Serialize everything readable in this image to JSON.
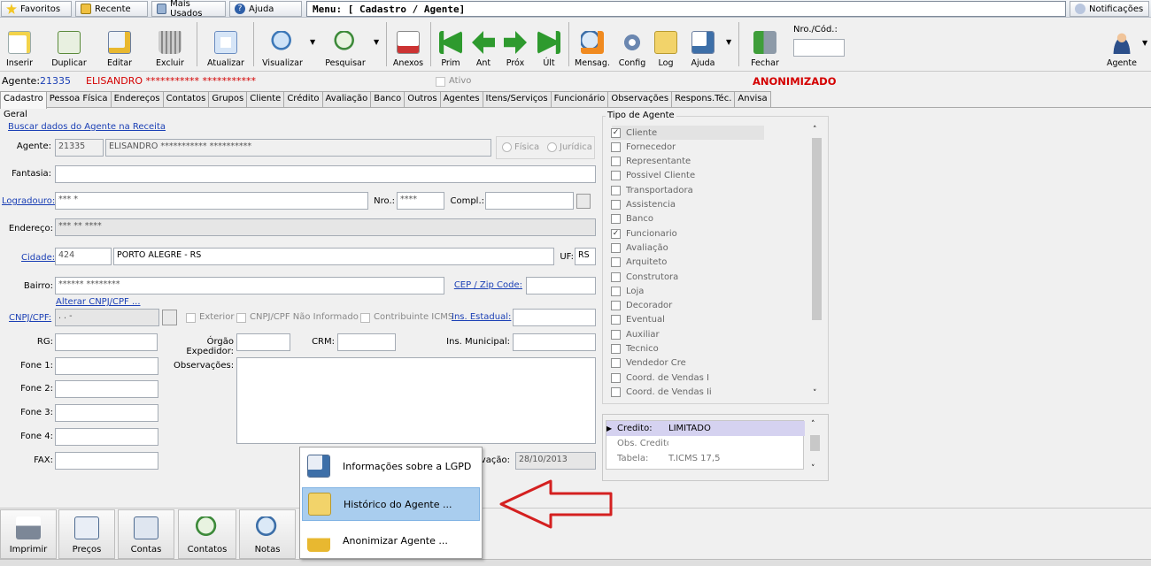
{
  "topbar": {
    "favoritos": "Favoritos",
    "recente": "Recente",
    "mais_usados": "Mais Usados",
    "ajuda": "Ajuda",
    "menu": "Menu: [ Cadastro / Agente]",
    "notificacoes": "Notificações"
  },
  "toolbar": {
    "inserir": "Inserir",
    "duplicar": "Duplicar",
    "editar": "Editar",
    "excluir": "Excluir",
    "atualizar": "Atualizar",
    "visualizar": "Visualizar",
    "pesquisar": "Pesquisar",
    "anexos": "Anexos",
    "prim": "Prim",
    "ant": "Ant",
    "prox": "Próx",
    "ult": "Últ",
    "mensag": "Mensag.",
    "config": "Config",
    "log": "Log",
    "ajuda": "Ajuda",
    "fechar": "Fechar",
    "nro_cod_label": "Nro./Cód.:",
    "agente": "Agente"
  },
  "agent_line": {
    "label": "Agente:",
    "id": "21335",
    "name": "ELISANDRO *********** ***********",
    "ativo": "Ativo",
    "status": "ANONIMIZADO"
  },
  "tabs": [
    "Cadastro",
    "Pessoa Física",
    "Endereços",
    "Contatos",
    "Grupos",
    "Cliente",
    "Crédito",
    "Avaliação",
    "Banco",
    "Outros",
    "Agentes",
    "Itens/Serviços",
    "Funcionário",
    "Observações",
    "Respons.Téc.",
    "Anvisa"
  ],
  "form": {
    "geral": "Geral",
    "buscar_receita": "Buscar dados do Agente na Receita",
    "agente_label": "Agente:",
    "agente_id": "21335",
    "agente_nome": "ELISANDRO *********** **********",
    "fisica": "Física",
    "juridica": "Jurídica",
    "fantasia_label": "Fantasia:",
    "logradouro_label": "Logradouro:",
    "logradouro": "*** *",
    "nro_label": "Nro.:",
    "nro": "****",
    "compl_label": "Compl.:",
    "endereco_label": "Endereço:",
    "endereco": "*** ** ****",
    "cidade_label": "Cidade:",
    "cidade_id": "424",
    "cidade_nome": "PORTO ALEGRE - RS",
    "uf_label": "UF:",
    "uf": "RS",
    "bairro_label": "Bairro:",
    "bairro": "****** ********",
    "cep_label": "CEP / Zip Code:",
    "alterar_cnpj": "Alterar CNPJ/CPF ...",
    "cnpj_label": "CNPJ/CPF:",
    "cnpj_value": " .  .  -",
    "exterior": "Exterior",
    "cnpj_nao_informado": "CNPJ/CPF Não Informado",
    "contribuinte_icms": "Contribuinte ICMS",
    "ins_estadual_label": "Ins. Estadual:",
    "rg_label": "RG:",
    "orgao_label": "Órgão Expedidor:",
    "crm_label": "CRM:",
    "ins_municipal_label": "Ins. Municipal:",
    "fone1": "Fone 1:",
    "fone2": "Fone 2:",
    "fone3": "Fone 3:",
    "fone4": "Fone 4:",
    "fax": "FAX:",
    "observacoes_label": "Observações:",
    "ativacao_label": "ivação:",
    "ativacao_date": "28/10/2013"
  },
  "tipo_agente": {
    "title": "Tipo de Agente",
    "items": [
      {
        "label": "Cliente",
        "checked": true
      },
      {
        "label": "Fornecedor",
        "checked": false
      },
      {
        "label": "Representante",
        "checked": false
      },
      {
        "label": "Possivel Cliente",
        "checked": false
      },
      {
        "label": "Transportadora",
        "checked": false
      },
      {
        "label": "Assistencia",
        "checked": false
      },
      {
        "label": "Banco",
        "checked": false
      },
      {
        "label": "Funcionario",
        "checked": true
      },
      {
        "label": "Avaliação",
        "checked": false
      },
      {
        "label": "Arquiteto",
        "checked": false
      },
      {
        "label": "Construtora",
        "checked": false
      },
      {
        "label": "Loja",
        "checked": false
      },
      {
        "label": "Decorador",
        "checked": false
      },
      {
        "label": "Eventual",
        "checked": false
      },
      {
        "label": "Auxiliar",
        "checked": false
      },
      {
        "label": "Tecnico",
        "checked": false
      },
      {
        "label": "Vendedor Cre",
        "checked": false
      },
      {
        "label": "Coord. de Vendas I",
        "checked": false
      },
      {
        "label": "Coord. de Vendas Ii",
        "checked": false
      }
    ]
  },
  "credit": {
    "rows": [
      {
        "key": "Credito:",
        "value": "LIMITADO"
      },
      {
        "key": "Obs. Credito",
        "value": ""
      },
      {
        "key": "Tabela:",
        "value": "T.ICMS 17,5"
      }
    ]
  },
  "bottom": {
    "imprimir": "Imprimir",
    "precos": "Preços",
    "contas": "Contas",
    "contatos": "Contatos",
    "notas": "Notas"
  },
  "popup": {
    "items": [
      "Informações sobre a LGPD",
      "Histórico do Agente ...",
      "Anonimizar Agente ..."
    ]
  },
  "colors": {
    "status_red": "#d40000",
    "link_blue": "#1a3fb5",
    "arrow_red": "#d42020",
    "highlight": "#a9cdee"
  }
}
